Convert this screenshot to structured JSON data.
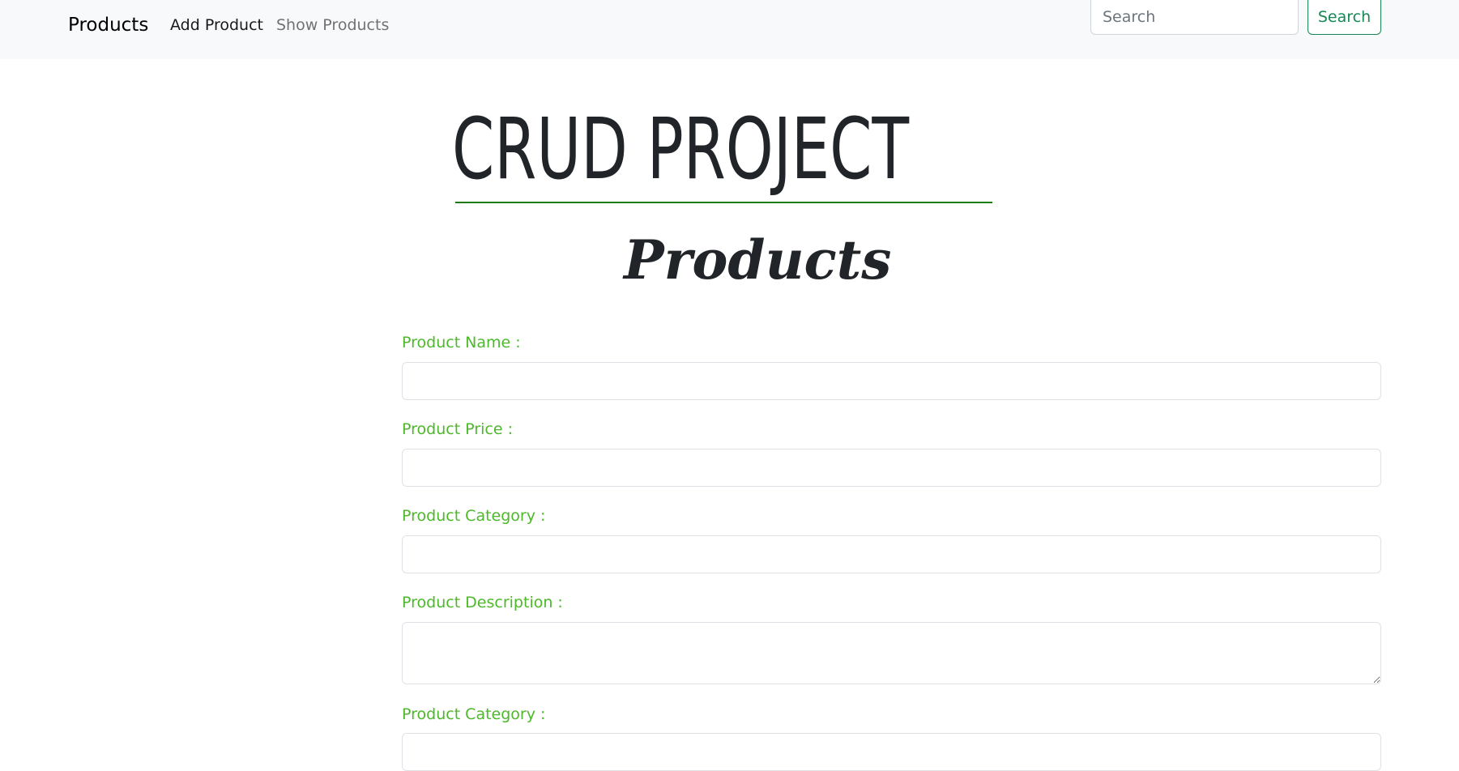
{
  "navbar": {
    "brand": "Products",
    "links": [
      {
        "label": "Add Product"
      },
      {
        "label": "Show Products"
      }
    ],
    "search": {
      "placeholder": "Search",
      "button_label": "Search"
    }
  },
  "main": {
    "title": "CRUD PROJECT",
    "subtitle": "Products",
    "fields": [
      {
        "label": "Product Name :",
        "value": ""
      },
      {
        "label": "Product Price :",
        "value": ""
      },
      {
        "label": "Product Category :",
        "value": ""
      },
      {
        "label": "Product Description :",
        "value": ""
      },
      {
        "label": "Product Category :",
        "value": ""
      }
    ]
  },
  "colors": {
    "label_green": "#4cb82a",
    "accent_green": "#198754",
    "rule_green": "#1e7b12",
    "navbar_bg": "#f8f9fa"
  }
}
